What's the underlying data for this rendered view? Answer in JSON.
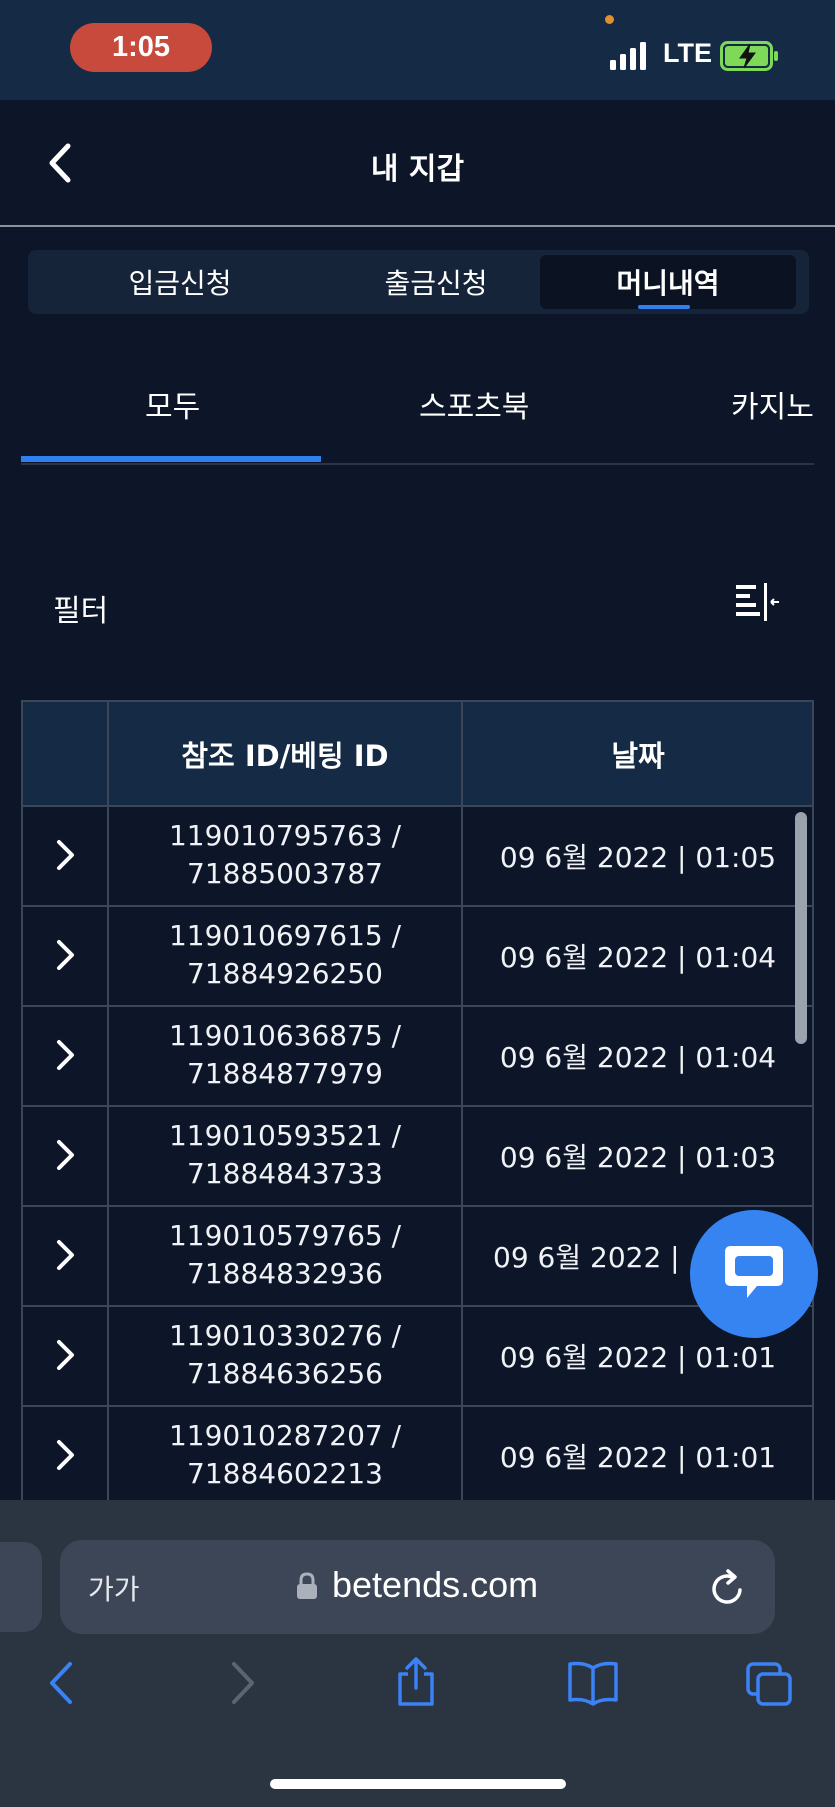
{
  "status_bar": {
    "time": "1:05",
    "network": "LTE"
  },
  "header": {
    "title": "내 지갑"
  },
  "wallet_tabs": [
    {
      "label": "입금신청",
      "active": false
    },
    {
      "label": "출금신청",
      "active": false
    },
    {
      "label": "머니내역",
      "active": true
    }
  ],
  "sub_tabs": [
    {
      "label": "모두",
      "active": true
    },
    {
      "label": "스포츠북",
      "active": false
    },
    {
      "label": "카지노",
      "active": false
    }
  ],
  "filter": {
    "label": "필터",
    "icon": "filter-sort-icon"
  },
  "table": {
    "headers": [
      "",
      "참조 ID/베팅 ID",
      "날짜"
    ],
    "rows": [
      {
        "ref_id": "119010795763 /",
        "bet_id": "71885003787",
        "date": "09 6월 2022 | 01:05"
      },
      {
        "ref_id": "119010697615 /",
        "bet_id": "71884926250",
        "date": "09 6월 2022 | 01:04"
      },
      {
        "ref_id": "119010636875 /",
        "bet_id": "71884877979",
        "date": "09 6월 2022 | 01:04"
      },
      {
        "ref_id": "119010593521 /",
        "bet_id": "71884843733",
        "date": "09 6월 2022 | 01:03"
      },
      {
        "ref_id": "119010579765 /",
        "bet_id": "71884832936",
        "date": "09 6월 2022 | "
      },
      {
        "ref_id": "119010330276 /",
        "bet_id": "71884636256",
        "date": "09 6월 2022 | 01:01"
      },
      {
        "ref_id": "119010287207 /",
        "bet_id": "71884602213",
        "date": "09 6월 2022 | 01:01"
      }
    ]
  },
  "chat": {
    "icon": "chat-bubble-icon",
    "color": "#3584f2"
  },
  "browser": {
    "text_size_label": "가가",
    "url": "betends.com",
    "icons": [
      "back-icon",
      "forward-icon",
      "share-icon",
      "bookmarks-icon",
      "tabs-icon"
    ]
  },
  "colors": {
    "background": "#0c1628",
    "accent": "#2f7ff0",
    "header_bg": "#142a45"
  }
}
